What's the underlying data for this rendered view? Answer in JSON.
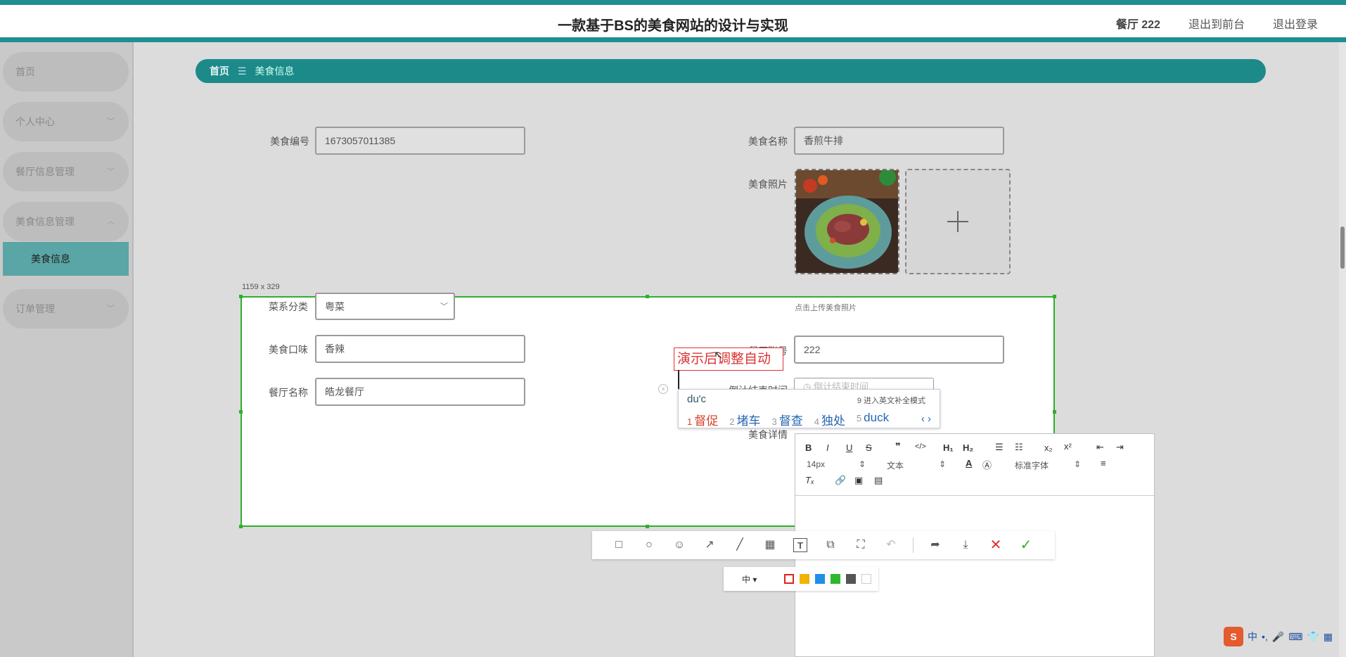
{
  "header": {
    "title": "一款基于BS的美食网站的设计与实现",
    "user": "餐厅 222",
    "link_front": "退出到前台",
    "link_logout": "退出登录"
  },
  "sidebar": {
    "items": [
      {
        "label": "首页"
      },
      {
        "label": "个人中心"
      },
      {
        "label": "餐厅信息管理"
      },
      {
        "label": "美食信息管理"
      },
      {
        "label": "订单管理"
      }
    ],
    "subitem": "美食信息"
  },
  "breadcrumb": {
    "home": "首页",
    "sep": "☰",
    "current": "美食信息"
  },
  "form": {
    "food_id_label": "美食编号",
    "food_id_value": "1673057011385",
    "food_name_label": "美食名称",
    "food_name_value": "香煎牛排",
    "photo_label": "美食照片",
    "upload_hint": "点击上传美食照片",
    "cuisine_label": "菜系分类",
    "cuisine_value": "粤菜",
    "taste_label": "美食口味",
    "taste_value": "香辣",
    "account_label": "餐厅账号",
    "account_value": "222",
    "restaurant_label": "餐厅名称",
    "restaurant_value": "皓龙餐厅",
    "expiry_label": "倒计结束时间",
    "expiry_placeholder": "倒计结束时间",
    "details_label": "美食详情"
  },
  "editor": {
    "font_size": "14px",
    "paragraph": "文本",
    "font_family": "标准字体"
  },
  "screenshot": {
    "size": "1159 x 329",
    "text_note": "演示后调整自动",
    "size_option": "中",
    "colors": [
      "#e02020",
      "#f2b200",
      "#1e90e8",
      "#2fb82f",
      "#555555",
      "#ffffff"
    ]
  },
  "ime": {
    "input": "du'c",
    "hint": "9 进入英文补全模式",
    "candidates": [
      {
        "n": "1",
        "w": "督促"
      },
      {
        "n": "2",
        "w": "堵车"
      },
      {
        "n": "3",
        "w": "督查"
      },
      {
        "n": "4",
        "w": "独处"
      },
      {
        "n": "5",
        "w": "duck"
      }
    ],
    "nav": "‹ ›"
  },
  "tray": {
    "ime_lang": "中"
  }
}
